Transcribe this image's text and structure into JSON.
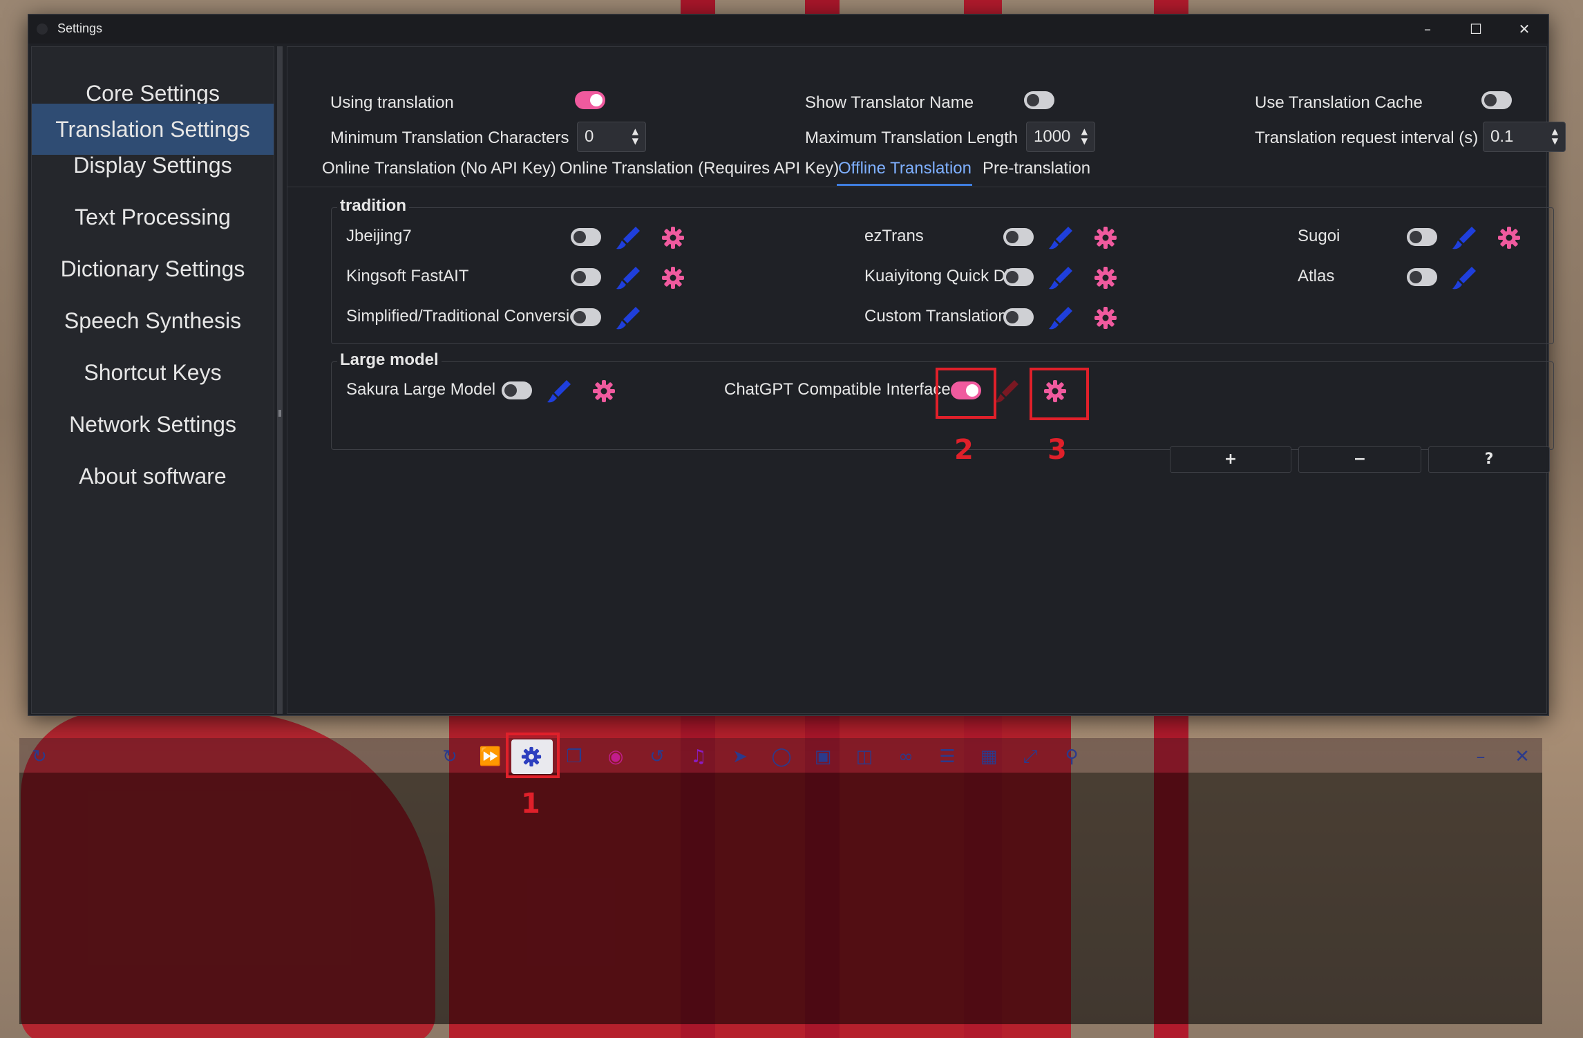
{
  "window": {
    "title": "Settings",
    "controls": [
      "minimize-icon",
      "maximize-icon",
      "close-icon"
    ]
  },
  "sidebar": {
    "items": [
      {
        "label": "Core Settings"
      },
      {
        "label": "Translation Settings",
        "active": true
      },
      {
        "label": "Display Settings"
      },
      {
        "label": "Text Processing"
      },
      {
        "label": "Dictionary Settings"
      },
      {
        "label": "Speech Synthesis"
      },
      {
        "label": "Shortcut Keys"
      },
      {
        "label": "Network Settings"
      },
      {
        "label": "About software"
      }
    ]
  },
  "top_settings": {
    "using_translation": {
      "label": "Using translation",
      "on": true
    },
    "show_translator_name": {
      "label": "Show Translator Name",
      "on": false
    },
    "use_translation_cache": {
      "label": "Use Translation Cache",
      "on": false
    },
    "min_chars": {
      "label": "Minimum Translation Characters",
      "value": "0"
    },
    "max_length": {
      "label": "Maximum Translation Length",
      "value": "1000"
    },
    "interval": {
      "label": "Translation request interval (s)",
      "value": "0.1"
    }
  },
  "tabs": [
    {
      "label": "Online Translation (No API Key)"
    },
    {
      "label": "Online Translation (Requires API Key)"
    },
    {
      "label": "Offline Translation",
      "active": true
    },
    {
      "label": "Pre-translation"
    }
  ],
  "tradition": {
    "title": "tradition",
    "items": [
      {
        "label": "Jbeijing7",
        "on": false
      },
      {
        "label": "ezTrans",
        "on": false
      },
      {
        "label": "Sugoi",
        "on": false
      },
      {
        "label": "Kingsoft FastAIT",
        "on": false
      },
      {
        "label": "Kuaiyitong Quick Dict",
        "on": false
      },
      {
        "label": "Atlas",
        "on": false
      },
      {
        "label": "Simplified/Traditional Conversion",
        "on": false
      },
      {
        "label": "Custom Translation",
        "on": false
      }
    ]
  },
  "large_model": {
    "title": "Large model",
    "items": [
      {
        "label": "Sakura Large Model",
        "on": false
      },
      {
        "label": "ChatGPT Compatible Interface",
        "on": true
      }
    ],
    "buttons": [
      "+",
      "−",
      "?"
    ]
  },
  "annotations": [
    "1",
    "2",
    "3"
  ],
  "colors": {
    "accent": "#f05a9e",
    "brush": "#1f3fdc",
    "gear": "#f05a9e",
    "highlight": "#e0202a",
    "nav_active": "#2f4c73"
  }
}
